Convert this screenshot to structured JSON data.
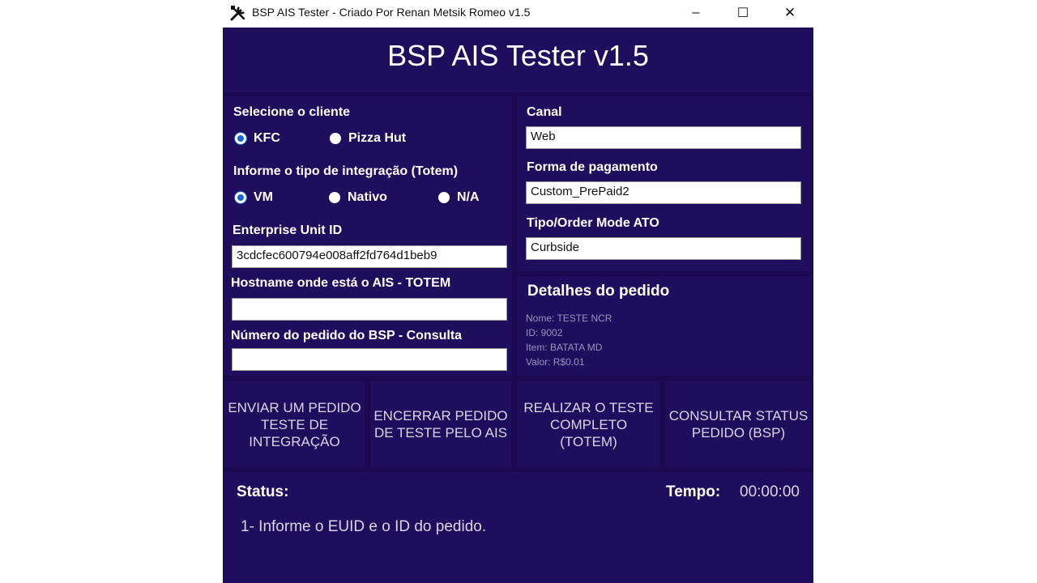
{
  "window": {
    "title": "BSP AIS Tester - Criado Por Renan Metsik Romeo v1.5",
    "minimize_glyph": "–",
    "maximize_glyph": "☐",
    "close_glyph": "✕"
  },
  "app_title": "BSP AIS Tester v1.5",
  "client": {
    "label": "Selecione o cliente",
    "options": [
      {
        "label": "KFC",
        "selected": true
      },
      {
        "label": "Pizza Hut",
        "selected": false
      }
    ]
  },
  "integration": {
    "label": "Informe o tipo de integração (Totem)",
    "options": [
      {
        "label": "VM",
        "selected": true
      },
      {
        "label": "Nativo",
        "selected": false
      },
      {
        "label": "N/A",
        "selected": false
      }
    ]
  },
  "euid": {
    "label": "Enterprise Unit ID",
    "value": "3cdcfec600794e008aff2fd764d1beb9"
  },
  "hostname": {
    "label": "Hostname onde está o AIS - TOTEM",
    "value": ""
  },
  "order_number": {
    "label": "Número do pedido do BSP - Consulta",
    "value": ""
  },
  "canal": {
    "label": "Canal",
    "value": "Web"
  },
  "payment": {
    "label": "Forma de pagamento",
    "value": "Custom_PrePaid2"
  },
  "order_mode": {
    "label": "Tipo/Order Mode ATO",
    "value": "Curbside"
  },
  "details": {
    "title": "Detalhes do pedido",
    "lines": [
      "Nome: TESTE NCR",
      "ID: 9002",
      "Item: BATATA MD",
      "Valor: R$0.01"
    ]
  },
  "buttons": {
    "send": "ENVIAR UM PEDIDO TESTE DE INTEGRAÇÃO",
    "close_order": "ENCERRAR PEDIDO DE TESTE PELO AIS",
    "full_test": "REALIZAR O TESTE COMPLETO (TOTEM)",
    "check_status": "CONSULTAR STATUS PEDIDO (BSP)"
  },
  "status": {
    "label": "Status:",
    "time_label": "Tempo:",
    "time_value": "00:00:00",
    "message": "1- Informe o EUID e o ID do pedido."
  },
  "colors": {
    "background": "#1b0a52",
    "panel": "#1f0e5e",
    "radio_selected": "#1a64d8"
  }
}
